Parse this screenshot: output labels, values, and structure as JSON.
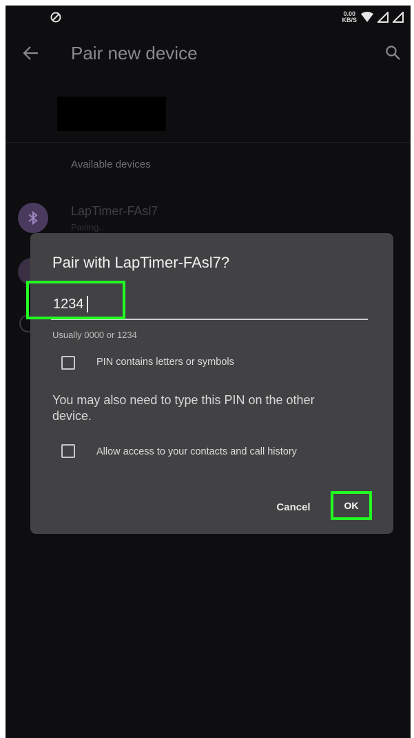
{
  "app_bar": {
    "title": "Pair new device"
  },
  "section": {
    "available_devices": "Available devices"
  },
  "device": {
    "name": "LapTimer-FAsl7",
    "status": "Pairing..."
  },
  "dialog": {
    "title": "Pair with LapTimer-FAsl7?",
    "pin_value": "1234",
    "hint": "Usually 0000 or 1234",
    "pin_letters_label": "PIN contains letters or symbols",
    "note": "You may also need to type this PIN on the other device.",
    "contacts_label": "Allow access to your contacts and call history",
    "cancel_label": "Cancel",
    "ok_label": "OK"
  },
  "status_bar": {
    "data_rate_top": "0.00",
    "data_rate_bottom": "KB/S"
  },
  "colors": {
    "highlight": "#22ff22",
    "background": "#0e0e10",
    "dialog": "#424244"
  }
}
